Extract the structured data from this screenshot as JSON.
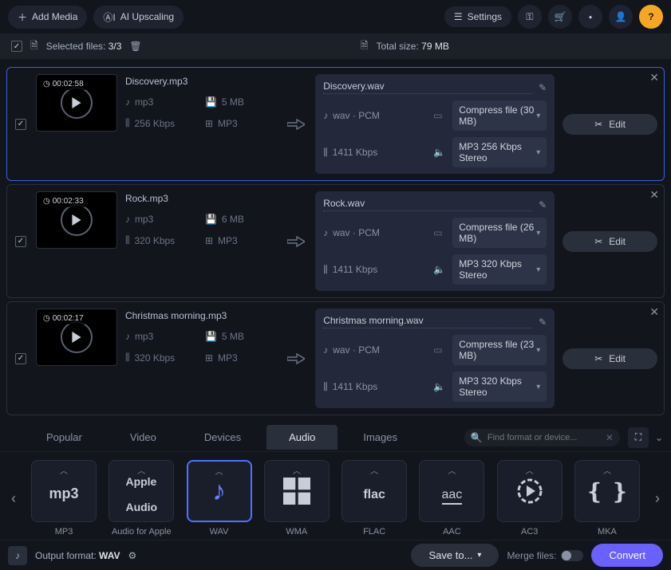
{
  "topbar": {
    "add_media": "Add Media",
    "ai_upscaling": "AI Upscaling",
    "settings": "Settings"
  },
  "status": {
    "selected_label": "Selected files:",
    "selected_count": "3/3",
    "total_label": "Total size:",
    "total_size": "79 MB"
  },
  "files": [
    {
      "duration": "00:02:58",
      "src_name": "Discovery.mp3",
      "src_fmt": "mp3",
      "src_size": "5 MB",
      "src_bitrate": "256 Kbps",
      "src_container": "MP3",
      "dest_name": "Discovery.wav",
      "dest_fmt": "wav · PCM",
      "dest_bitrate": "1411 Kbps",
      "compress": "Compress file (30 MB)",
      "quality": "MP3 256 Kbps Stereo",
      "selected": true
    },
    {
      "duration": "00:02:33",
      "src_name": "Rock.mp3",
      "src_fmt": "mp3",
      "src_size": "6 MB",
      "src_bitrate": "320 Kbps",
      "src_container": "MP3",
      "dest_name": "Rock.wav",
      "dest_fmt": "wav · PCM",
      "dest_bitrate": "1411 Kbps",
      "compress": "Compress file (26 MB)",
      "quality": "MP3 320 Kbps Stereo",
      "selected": false
    },
    {
      "duration": "00:02:17",
      "src_name": "Christmas morning.mp3",
      "src_fmt": "mp3",
      "src_size": "5 MB",
      "src_bitrate": "320 Kbps",
      "src_container": "MP3",
      "dest_name": "Christmas morning.wav",
      "dest_fmt": "wav · PCM",
      "dest_bitrate": "1411 Kbps",
      "compress": "Compress file (23 MB)",
      "quality": "MP3 320 Kbps Stereo",
      "selected": false
    }
  ],
  "edit_label": "Edit",
  "tabs": {
    "popular": "Popular",
    "video": "Video",
    "devices": "Devices",
    "audio": "Audio",
    "images": "Images"
  },
  "search_placeholder": "Find format or device...",
  "formats": [
    {
      "label": "MP3",
      "icon": "mp3"
    },
    {
      "label": "Audio for Apple",
      "icon": "apple"
    },
    {
      "label": "WAV",
      "icon": "note",
      "active": true
    },
    {
      "label": "WMA",
      "icon": "win"
    },
    {
      "label": "FLAC",
      "icon": "flac"
    },
    {
      "label": "AAC",
      "icon": "aac"
    },
    {
      "label": "AC3",
      "icon": "ac3"
    },
    {
      "label": "MKA",
      "icon": "mka"
    }
  ],
  "bottom": {
    "output_label": "Output format:",
    "output_value": "WAV",
    "save_to": "Save to...",
    "merge": "Merge files:",
    "convert": "Convert"
  }
}
